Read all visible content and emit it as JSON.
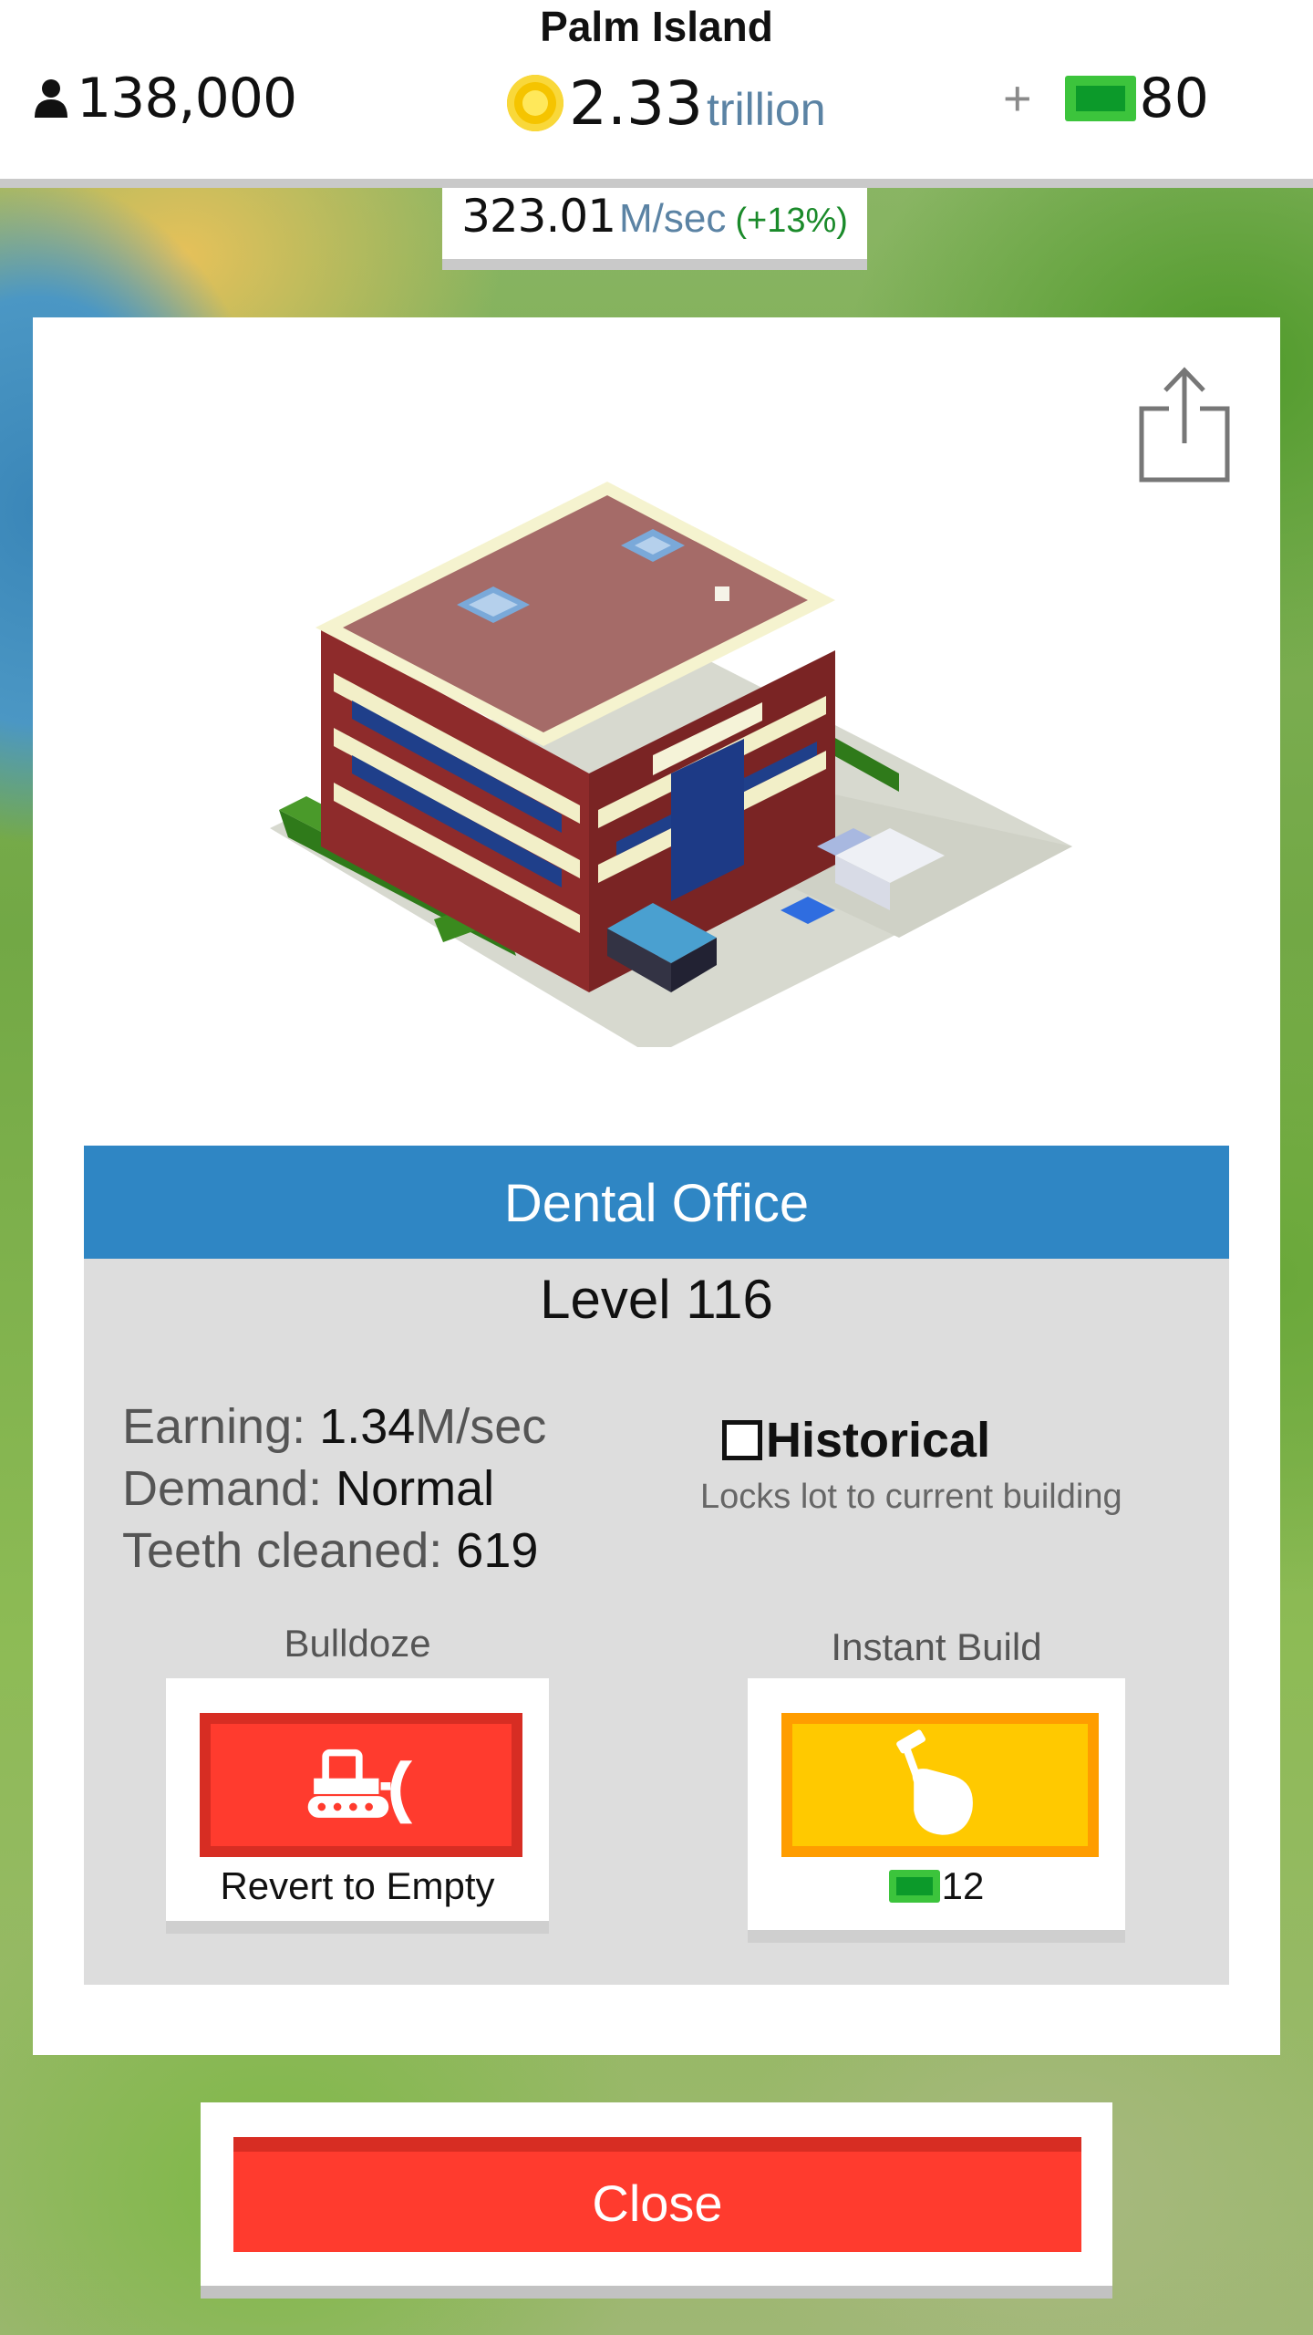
{
  "header": {
    "city_name": "Palm Island",
    "population": "138,000",
    "coins_amount": "2.33",
    "coins_unit": "trillion",
    "add_symbol": "+",
    "cash_amount": "80"
  },
  "income": {
    "amount": "323.01",
    "unit": "M/sec",
    "change": "(+13%)"
  },
  "building": {
    "name": "Dental Office",
    "level": "Level 116",
    "stats": {
      "earning_label": "Earning:",
      "earning_value": "1.34",
      "earning_unit": "M/sec",
      "demand_label": "Demand:",
      "demand_value": "Normal",
      "metric_label": "Teeth cleaned:",
      "metric_value": "619"
    },
    "historical": {
      "label": "Historical",
      "description": "Locks lot to current building",
      "checked": false
    }
  },
  "actions": {
    "bulldoze_title": "Bulldoze",
    "bulldoze_caption": "Revert to Empty",
    "instant_build_title": "Instant Build",
    "instant_build_cost": "12",
    "close_label": "Close"
  },
  "icons": {
    "population": "person-icon",
    "coins": "coin-icon",
    "cash": "cash-icon",
    "share": "share-icon",
    "bulldoze": "bulldozer-icon",
    "instant_build": "hammer-hand-icon"
  },
  "colors": {
    "title_bar": "#2f86c4",
    "bulldoze_button": "#ff3b2e",
    "instant_build_button": "#ffc900",
    "close_button": "#ff3b2e",
    "income_change": "#1a8a2a",
    "unit_text": "#5b83a4"
  }
}
